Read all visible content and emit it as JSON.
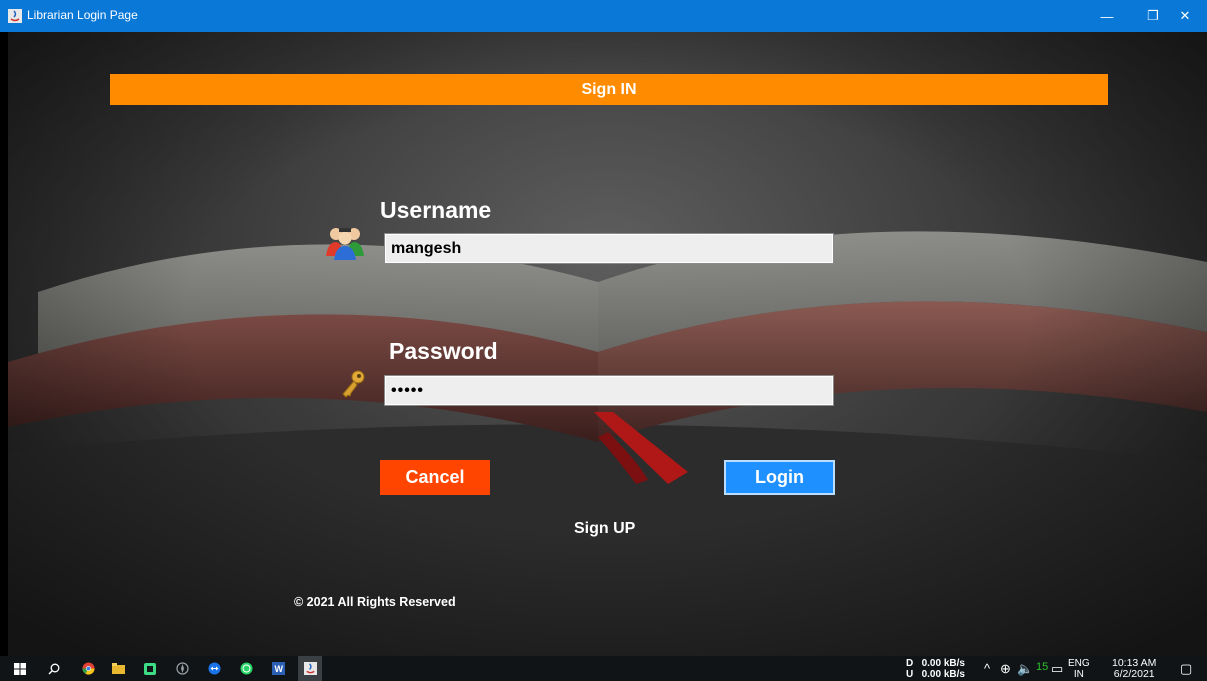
{
  "window": {
    "title": "Librarian Login Page",
    "minimize_glyph": "—",
    "maximize_glyph": "❐",
    "close_glyph": "✕"
  },
  "form": {
    "banner": "Sign IN",
    "username_label": "Username",
    "username_value": "mangesh",
    "password_label": "Password",
    "password_value": "•••••",
    "cancel_label": "Cancel",
    "login_label": "Login",
    "signup_label": "Sign UP",
    "copyright": "© 2021 All Rights Reserved"
  },
  "colors": {
    "banner": "#ff8c00",
    "cancel": "#ff4500",
    "login": "#1e90ff",
    "titlebar": "#0a78d7"
  },
  "taskbar": {
    "icons": [
      "windows-start-icon",
      "search-icon",
      "chrome-icon",
      "file-explorer-icon",
      "android-studio-icon",
      "browser-icon",
      "teamviewer-icon",
      "whatsapp-icon",
      "word-icon",
      "java-app-icon"
    ],
    "net_down_label": "D",
    "net_up_label": "U",
    "net_down": "0.00 kB/s",
    "net_up": "0.00 kB/s",
    "volume_number": "15",
    "language": "ENG",
    "region": "IN",
    "time": "10:13 AM",
    "date": "6/2/2021"
  }
}
